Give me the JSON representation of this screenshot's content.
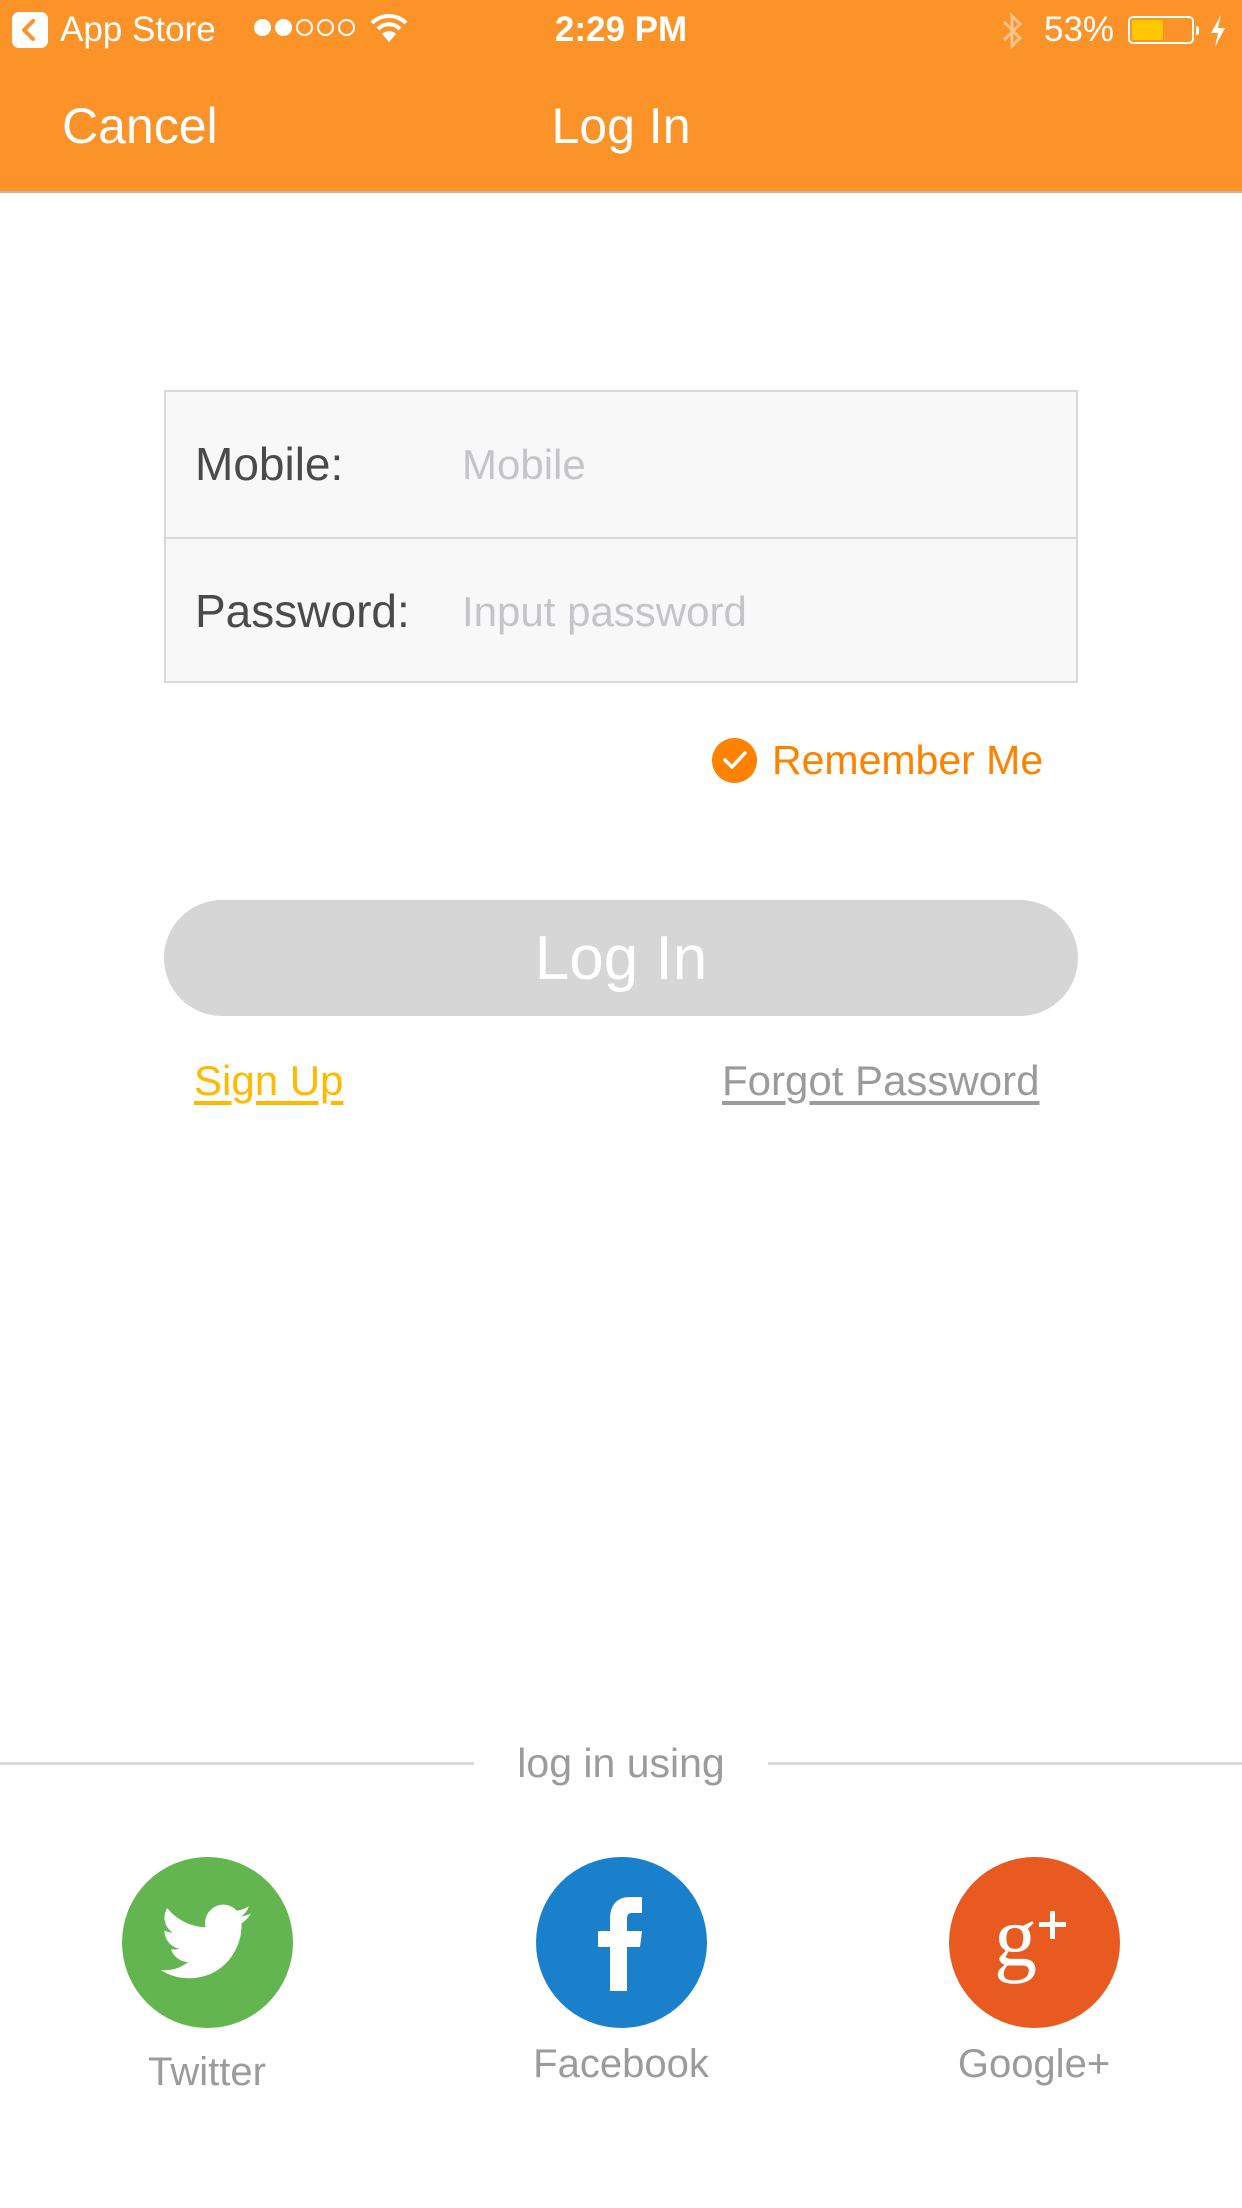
{
  "status_bar": {
    "back_app": "App Store",
    "signal_bars_filled": 2,
    "signal_bars_total": 5,
    "time": "2:29 PM",
    "battery_percent_label": "53%",
    "battery_level": 0.53,
    "charging": true,
    "bluetooth": true,
    "wifi": true
  },
  "nav": {
    "cancel_label": "Cancel",
    "title": "Log In"
  },
  "form": {
    "mobile": {
      "label": "Mobile:",
      "placeholder": "Mobile",
      "value": ""
    },
    "password": {
      "label": "Password:",
      "placeholder": "Input password",
      "value": ""
    }
  },
  "remember_me": {
    "label": "Remember Me",
    "checked": true
  },
  "login_button": {
    "label": "Log In",
    "enabled": false
  },
  "links": {
    "sign_up": "Sign Up",
    "forgot_password": "Forgot Password"
  },
  "social": {
    "divider_text": "log in using",
    "providers": [
      {
        "name": "Twitter",
        "icon": "twitter-bird-icon",
        "color": "#63B64F"
      },
      {
        "name": "Facebook",
        "icon": "facebook-f-icon",
        "color": "#1A80CB"
      },
      {
        "name": "Google+",
        "icon": "google-plus-icon",
        "color": "#E85A20"
      }
    ]
  },
  "colors": {
    "header": "#FC9329",
    "accent_orange": "#FC8200",
    "sign_up_yellow": "#FFBA00",
    "button_disabled": "#D6D6D6",
    "muted_text": "#9B9B9B"
  }
}
